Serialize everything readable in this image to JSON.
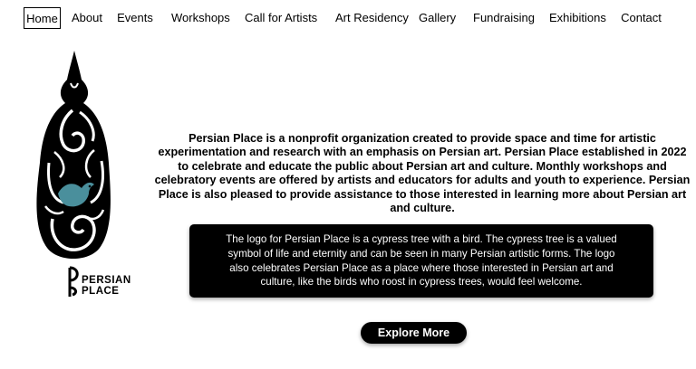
{
  "nav": {
    "items": [
      {
        "label": "Home",
        "active": true
      },
      {
        "label": "About"
      },
      {
        "label": "Events"
      },
      {
        "label": "Workshops"
      },
      {
        "label": "Call for Artists"
      },
      {
        "label": "Art Residency"
      },
      {
        "label": "Gallery"
      },
      {
        "label": "Fundraising"
      },
      {
        "label": "Exhibitions"
      },
      {
        "label": "Contact"
      }
    ]
  },
  "logo": {
    "icon": "cypress-tree-with-bird-icon",
    "wordmark_line1": "PERSIAN",
    "wordmark_line2": "PLACE",
    "bird_color": "#4a8f9c"
  },
  "main": {
    "intro": "Persian Place is a nonprofit organization created to provide space and time for artistic experimentation and research with an emphasis on Persian art. Persian Place established in 2022 to celebrate and educate the public about Persian art and culture. Monthly workshops and celebratory events are offered by artists and educators for adults and youth to experience. Persian Place is also pleased to provide assistance to those interested in learning more about Persian art and culture.",
    "logo_description": "The logo for Persian Place is a cypress tree with a bird. The cypress tree is a valued symbol of life and eternity and can be seen in many Persian artistic forms. The logo also celebrates Persian Place as a place where those interested in Persian art and culture, like the birds who roost in cypress trees, would feel welcome.",
    "explore_label": "Explore More"
  }
}
